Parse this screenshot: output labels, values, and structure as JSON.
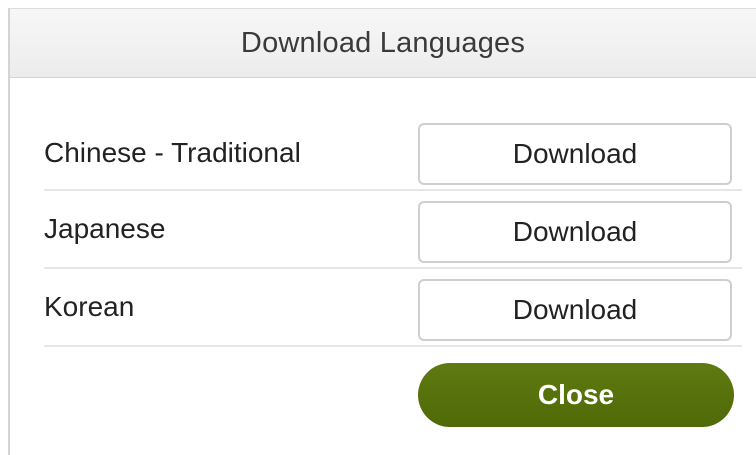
{
  "dialog": {
    "title": "Download Languages"
  },
  "languages": [
    {
      "name": "Chinese - Traditional",
      "button_label": "Download"
    },
    {
      "name": "Japanese",
      "button_label": "Download"
    },
    {
      "name": "Korean",
      "button_label": "Download"
    }
  ],
  "close_label": "Close",
  "colors": {
    "close_button": "#56700a",
    "close_text": "#ffffff",
    "title_text": "#3a3a3a",
    "row_divider": "#e6e6e6"
  }
}
